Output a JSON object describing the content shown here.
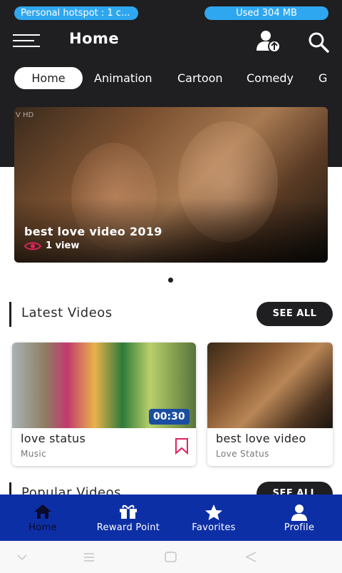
{
  "status_bar": {
    "hotspot_text": "Personal hotspot : 1 c...",
    "data_used": "Used  304 MB"
  },
  "header": {
    "title": "Home",
    "tabs": [
      "Home",
      "Animation",
      "Cartoon",
      "Comedy",
      "G"
    ]
  },
  "banner": {
    "watermark": "V HD",
    "title": "best love video 2019",
    "views": "1 view"
  },
  "latest": {
    "heading": "Latest Videos",
    "see_all": "SEE ALL",
    "cards": [
      {
        "title": "love status",
        "category": "Music",
        "duration": "00:30"
      },
      {
        "title": "best love video",
        "category": "Love Status"
      }
    ]
  },
  "popular": {
    "heading": "Popular Videos",
    "see_all": "SEE ALL"
  },
  "bottom_nav": {
    "items": [
      {
        "label": "Home",
        "icon": "home-icon"
      },
      {
        "label": "Reward Point",
        "icon": "gift-icon"
      },
      {
        "label": "Favorites",
        "icon": "star-icon"
      },
      {
        "label": "Profile",
        "icon": "person-icon"
      }
    ]
  },
  "colors": {
    "header_bg": "#1f1e20",
    "accent_blue": "#2fa7f0",
    "nav_bg": "#0d2fa6",
    "views_icon": "#e0245e"
  }
}
